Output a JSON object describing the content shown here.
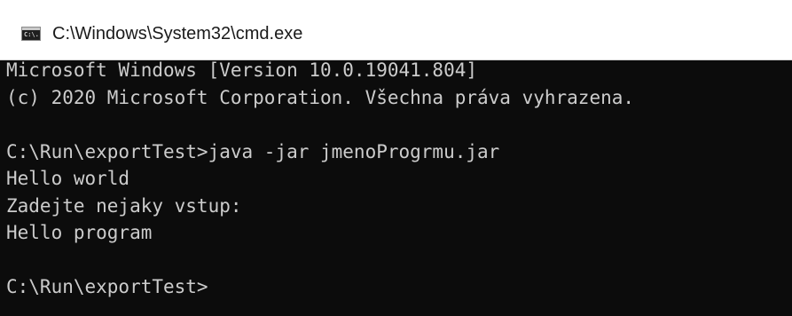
{
  "window": {
    "title": "C:\\Windows\\System32\\cmd.exe",
    "icon": "cmd-icon",
    "icon_text": "C:\\."
  },
  "console": {
    "lines": [
      "Microsoft Windows [Version 10.0.19041.804]",
      "(c) 2020 Microsoft Corporation. Všechna práva vyhrazena.",
      "",
      "C:\\Run\\exportTest>java -jar jmenoProgrmu.jar",
      "Hello world",
      "Zadejte nejaky vstup:",
      "Hello program",
      "",
      "C:\\Run\\exportTest>"
    ],
    "text_color": "#cccccc",
    "background": "#0c0c0c"
  }
}
